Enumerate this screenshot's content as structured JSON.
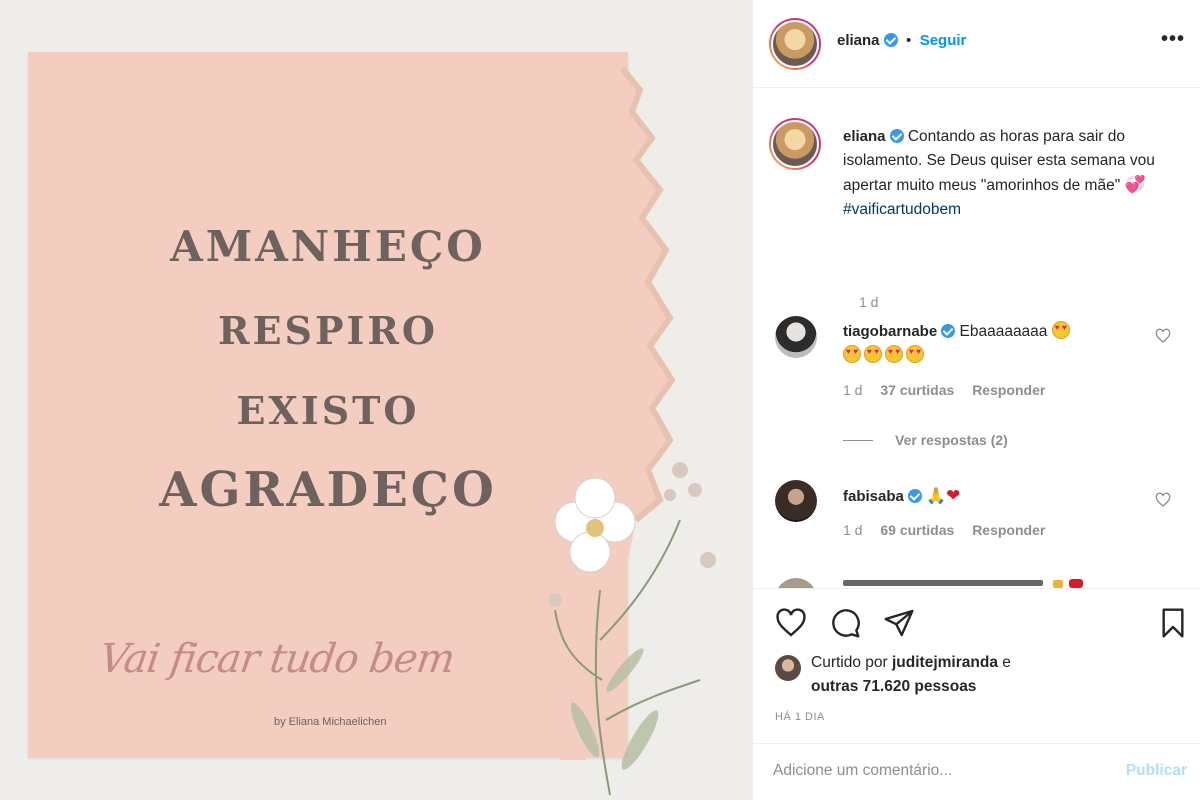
{
  "post_image": {
    "lines": [
      "AMANHEÇO",
      "RESPIRO",
      "EXISTO",
      "AGRADEÇO"
    ],
    "script_title": "Vai ficar tudo bem",
    "byline": "by Eliana Michaelichen",
    "paper_color": "#f2cdc0"
  },
  "header": {
    "username": "eliana",
    "separator": "•",
    "follow_label": "Seguir",
    "more_label": "•••"
  },
  "caption": {
    "username": "eliana",
    "text": "Contando as horas para sair do isolamento. Se Deus quiser esta semana vou apertar muito meus \"amorinhos de mãe\"",
    "emoji": "💞",
    "hashtag": "#vaificartudobem",
    "time": "1 d"
  },
  "comments": [
    {
      "username": "tiagobarnabe",
      "text": "Ebaaaaaaaa",
      "time": "1 d",
      "likes": "37 curtidas",
      "reply_label": "Responder",
      "view_replies": "Ver respostas (2)"
    },
    {
      "username": "fabisaba",
      "text": "",
      "time": "1 d",
      "likes": "69 curtidas",
      "reply_label": "Responder"
    }
  ],
  "liked_by": {
    "prefix": "Curtido por",
    "user": "juditejmiranda",
    "conjunction": "e",
    "others": "outras 71.620 pessoas"
  },
  "posted_ago": "HÁ 1 DIA",
  "add_comment": {
    "placeholder": "Adicione um comentário...",
    "publish_label": "Publicar"
  },
  "colors": {
    "accent": "#0095f6",
    "verified": "#3897f0",
    "hashtag": "#00376b",
    "muted": "#8e8e8e"
  }
}
